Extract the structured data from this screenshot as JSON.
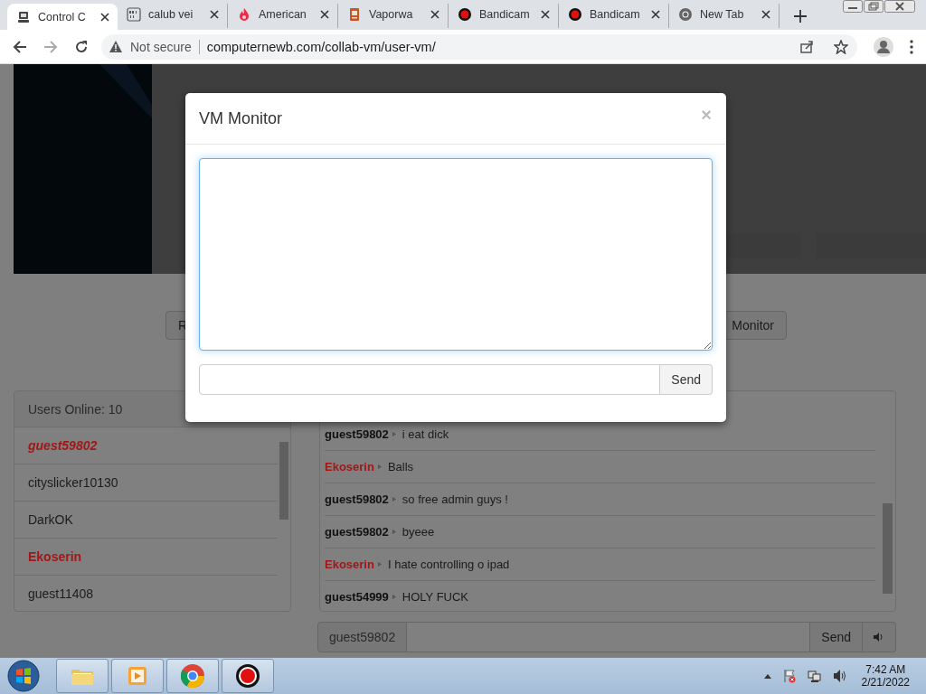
{
  "browser": {
    "tabs": [
      {
        "title": "Control C",
        "kind": "computer",
        "selected": true
      },
      {
        "title": "calub vei",
        "kind": "binary",
        "selected": false
      },
      {
        "title": "American",
        "kind": "flame",
        "selected": false
      },
      {
        "title": "Vaporwa",
        "kind": "document",
        "selected": false
      },
      {
        "title": "Bandicam",
        "kind": "record",
        "selected": false
      },
      {
        "title": "Bandicam",
        "kind": "record",
        "selected": false
      },
      {
        "title": "New Tab",
        "kind": "chrome",
        "selected": false
      }
    ],
    "security": "Not secure",
    "url": "computernewb.com/collab-vm/user-vm/"
  },
  "page": {
    "buttons": [
      {
        "label": "R"
      },
      {
        "label": "Monitor"
      }
    ],
    "users": {
      "header": "Users Online: 10",
      "items": [
        {
          "name": "guest59802",
          "color": "#a01818",
          "self": true
        },
        {
          "name": "cityslicker10130",
          "color": "#1c1c1c",
          "self": false
        },
        {
          "name": "DarkOK",
          "color": "#1c1c1c",
          "self": false
        },
        {
          "name": "Ekoserin",
          "color": "#a01818",
          "self": false
        },
        {
          "name": "guest11408",
          "color": "#1c1c1c",
          "self": false
        }
      ]
    },
    "chat": {
      "messages": [
        {
          "user": "guest59802",
          "color": "#111111",
          "text": "i eat dick"
        },
        {
          "user": "Ekoserin",
          "color": "#a01818",
          "text": "Balls"
        },
        {
          "user": "guest59802",
          "color": "#111111",
          "text": "so free admin guys !"
        },
        {
          "user": "guest59802",
          "color": "#111111",
          "text": "byeee"
        },
        {
          "user": "Ekoserin",
          "color": "#a01818",
          "text": "I hate controlling o ipad"
        },
        {
          "user": "guest54999",
          "color": "#111111",
          "text": "HOLY FUCK"
        }
      ],
      "username": "guest59802",
      "send": "Send"
    }
  },
  "modal": {
    "title": "VM Monitor",
    "close": "×",
    "send": "Send"
  },
  "taskbar": {
    "apps": [
      {
        "kind": "folder"
      },
      {
        "kind": "player"
      },
      {
        "kind": "chrome"
      },
      {
        "kind": "record"
      }
    ],
    "time": "7:42 AM",
    "date": "2/21/2022"
  }
}
